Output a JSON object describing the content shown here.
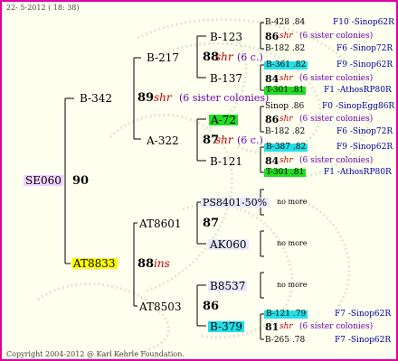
{
  "header": {
    "date": "22-  5-2012 ( 18: 38)"
  },
  "footer": {
    "copyright": "Copyright 2004-2012 @ Karl Kehrle Foundation."
  },
  "root": {
    "id": "SE060",
    "num": "90"
  },
  "gen1": {
    "top": {
      "id": "B-342",
      "num": "89",
      "tag": "shr",
      "note": "(6 sister colonies)"
    },
    "bottom": {
      "id": "AT8833",
      "num": "88",
      "tag": "ins"
    }
  },
  "gen2": {
    "b217": {
      "id": "B-217",
      "num": "88",
      "tag": "shr",
      "note": "(6 c.)"
    },
    "a322": {
      "id": "A-322",
      "num": "87",
      "tag": "shr",
      "note": "(6 c.)"
    },
    "at8601": {
      "id": "AT8601",
      "num": "87"
    },
    "at8503": {
      "id": "AT8503",
      "num": "86"
    }
  },
  "gen3": {
    "b123": "B-123",
    "b137": "B-137",
    "a72": "A-72",
    "b121": "B-121",
    "ps8401": "PS8401-50%",
    "ak060": "AK060",
    "b8537": "B8537",
    "b379": "B-379"
  },
  "gen4": [
    {
      "left": "B-428 .84",
      "right": "F10 -Sinop62R"
    },
    {
      "num": "86",
      "tag": "shr",
      "note": "(6 sister colonies)"
    },
    {
      "left": "B-182 .82",
      "right": "F6 -Sinop72R"
    },
    {
      "left": "B-361 .82",
      "right": "F9 -Sinop62R"
    },
    {
      "num": "84",
      "tag": "shr",
      "note": "(6 sister colonies)"
    },
    {
      "left": "T-301 .81",
      "right": "F1 -AthosRP80R"
    },
    {
      "left": "Sinop .86",
      "right": "F0 -SinopEgg86R"
    },
    {
      "num": "86",
      "tag": "shr",
      "note": "(6 sister colonies)"
    },
    {
      "left": "B-182 .82",
      "right": "F6 -Sinop72R"
    },
    {
      "left": "B-387 .82",
      "right": "F9 -Sinop62R"
    },
    {
      "num": "84",
      "tag": "shr",
      "note": "(6 sister colonies)"
    },
    {
      "left": "T-301 .81",
      "right": "F1 -AthosRP80R"
    },
    {
      "nomore": "no more"
    },
    {
      "nomore": "no more"
    },
    {
      "nomore": "no more"
    },
    {
      "left": "B-121 .79",
      "right": "F7 -Sinop62R"
    },
    {
      "num": "81",
      "tag": "shr",
      "note": "(6 sister colonies)"
    },
    {
      "left": "B-265 .78",
      "right": "F7 -Sinop62R"
    }
  ]
}
